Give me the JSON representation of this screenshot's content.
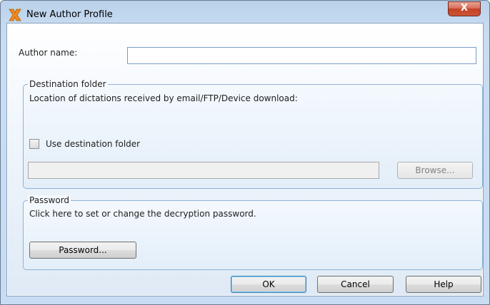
{
  "window": {
    "title": "New Author Profile",
    "close_label": "X",
    "app_icon": "app-logo-icon"
  },
  "author": {
    "label": "Author name:",
    "value": ""
  },
  "destination": {
    "legend": "Destination folder",
    "description": "Location of dictations received by email/FTP/Device download:",
    "checkbox_label": "Use destination folder",
    "checkbox_checked": false,
    "path_value": "",
    "browse_label": "Browse..."
  },
  "password": {
    "legend": "Password",
    "description": "Click here to set or change the decryption password.",
    "button_label": "Password..."
  },
  "footer": {
    "ok_label": "OK",
    "cancel_label": "Cancel",
    "help_label": "Help"
  },
  "colors": {
    "title_gradient": "#c5daf0",
    "close_button": "#c34124",
    "group_border": "#8fb2d6"
  }
}
